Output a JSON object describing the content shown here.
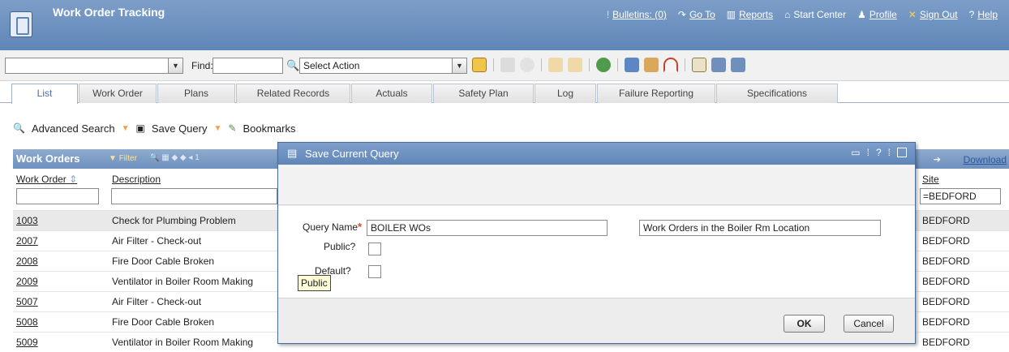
{
  "app": {
    "title": "Work Order Tracking",
    "nav": [
      {
        "icon": "bulletin-icon",
        "label": "Bulletins: (0)"
      },
      {
        "icon": "goto-arrow-icon",
        "label": "Go To"
      },
      {
        "icon": "reports-icon",
        "label": "Reports"
      },
      {
        "icon": "start-center-icon",
        "label": "Start Center"
      },
      {
        "icon": "profile-icon",
        "label": "Profile"
      },
      {
        "icon": "sign-out-icon",
        "label": "Sign Out"
      },
      {
        "icon": "help-icon",
        "label": "Help"
      }
    ]
  },
  "toolbar": {
    "query_select_value": "",
    "find_label": "Find:",
    "find_value": "",
    "action_select_value": "Select Action"
  },
  "tabs": [
    "List",
    "Work Order",
    "Plans",
    "Related Records",
    "Actuals",
    "Safety Plan",
    "Log",
    "Failure Reporting",
    "Specifications"
  ],
  "active_tab": "List",
  "querybar": {
    "advanced_search": "Advanced Search",
    "save_query": "Save Query",
    "bookmarks": "Bookmarks"
  },
  "list": {
    "title": "Work Orders",
    "filter_label": "Filter",
    "download_label": "Download",
    "columns": {
      "work_order": "Work Order",
      "description": "Description",
      "site": "Site"
    },
    "site_filter_value": "=BEDFORD",
    "rows": [
      {
        "work_order": "1003",
        "description": "Check for Plumbing Problem",
        "site": "BEDFORD"
      },
      {
        "work_order": "2007",
        "description": "Air Filter - Check-out",
        "site": "BEDFORD"
      },
      {
        "work_order": "2008",
        "description": "Fire Door Cable Broken",
        "site": "BEDFORD"
      },
      {
        "work_order": "2009",
        "description": "Ventilator in Boiler Room Making",
        "site": "BEDFORD"
      },
      {
        "work_order": "5007",
        "description": "Air Filter - Check-out",
        "site": "BEDFORD"
      },
      {
        "work_order": "5008",
        "description": "Fire Door Cable Broken",
        "site": "BEDFORD"
      },
      {
        "work_order": "5009",
        "description": "Ventilator in Boiler Room Making",
        "site": "BEDFORD"
      }
    ]
  },
  "dialog": {
    "title": "Save Current Query",
    "query_name_label": "Query Name",
    "query_name_value": "BOILER WOs",
    "description_value": "Work Orders in the Boiler Rm Location",
    "public_label": "Public?",
    "default_label": "Default?",
    "tooltip": "Public",
    "ok_label": "OK",
    "cancel_label": "Cancel",
    "help_glyph": "?"
  }
}
